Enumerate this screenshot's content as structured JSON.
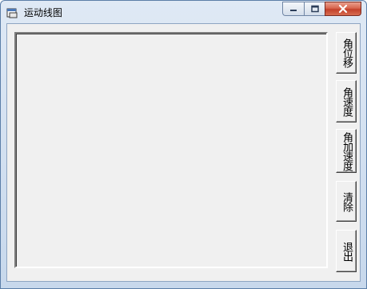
{
  "window": {
    "title": "运动线图"
  },
  "caption_buttons": {
    "minimize_icon": "minimize-icon",
    "maximize_icon": "maximize-icon",
    "close_icon": "close-icon"
  },
  "buttons": {
    "angular_displacement": "角位移",
    "angular_velocity": "角速度",
    "angular_acceleration": "角加速度",
    "clear": "清除",
    "exit": "退出"
  }
}
